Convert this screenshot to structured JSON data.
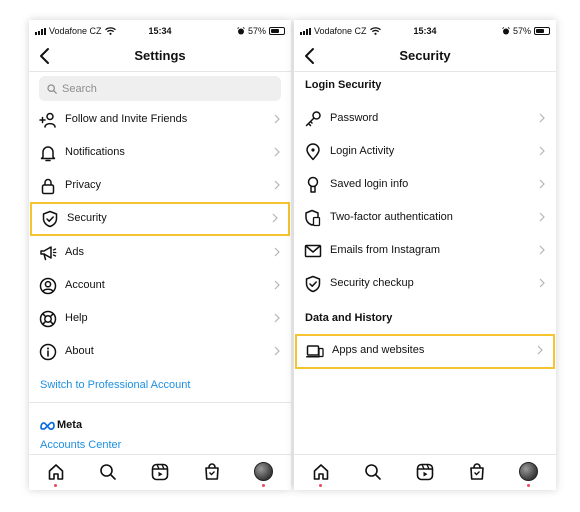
{
  "status_bar": {
    "carrier": "Vodafone CZ",
    "time": "15:34",
    "battery": "57%",
    "battery_level": 0.57
  },
  "settings": {
    "title": "Settings",
    "search_placeholder": "Search",
    "items": [
      {
        "label": "Follow and Invite Friends",
        "icon": "add-person-icon"
      },
      {
        "label": "Notifications",
        "icon": "bell-icon"
      },
      {
        "label": "Privacy",
        "icon": "lock-icon"
      },
      {
        "label": "Security",
        "icon": "shield-icon",
        "highlighted": true
      },
      {
        "label": "Ads",
        "icon": "megaphone-icon"
      },
      {
        "label": "Account",
        "icon": "account-circle-icon"
      },
      {
        "label": "Help",
        "icon": "lifebuoy-icon"
      },
      {
        "label": "About",
        "icon": "info-icon"
      }
    ],
    "switch_professional": "Switch to Professional Account",
    "meta_label": "Meta",
    "accounts_center": "Accounts Center"
  },
  "security": {
    "title": "Security",
    "login_section": "Login Security",
    "login_items": [
      {
        "label": "Password",
        "icon": "key-icon"
      },
      {
        "label": "Login Activity",
        "icon": "location-pin-icon"
      },
      {
        "label": "Saved login info",
        "icon": "keyhole-icon"
      },
      {
        "label": "Two-factor authentication",
        "icon": "shield-phone-icon"
      },
      {
        "label": "Emails from Instagram",
        "icon": "mail-icon"
      },
      {
        "label": "Security checkup",
        "icon": "shield-check-icon"
      }
    ],
    "data_section": "Data and History",
    "data_items": [
      {
        "label": "Apps and websites",
        "icon": "devices-icon",
        "highlighted": true
      }
    ]
  },
  "tab_bar": {
    "tabs": [
      "home-icon",
      "search-icon",
      "reels-icon",
      "shop-icon",
      "profile-avatar"
    ]
  },
  "colors": {
    "highlight_border": "#f5c430",
    "link": "#1d8fe1",
    "notification_dot": "#ed4956"
  }
}
